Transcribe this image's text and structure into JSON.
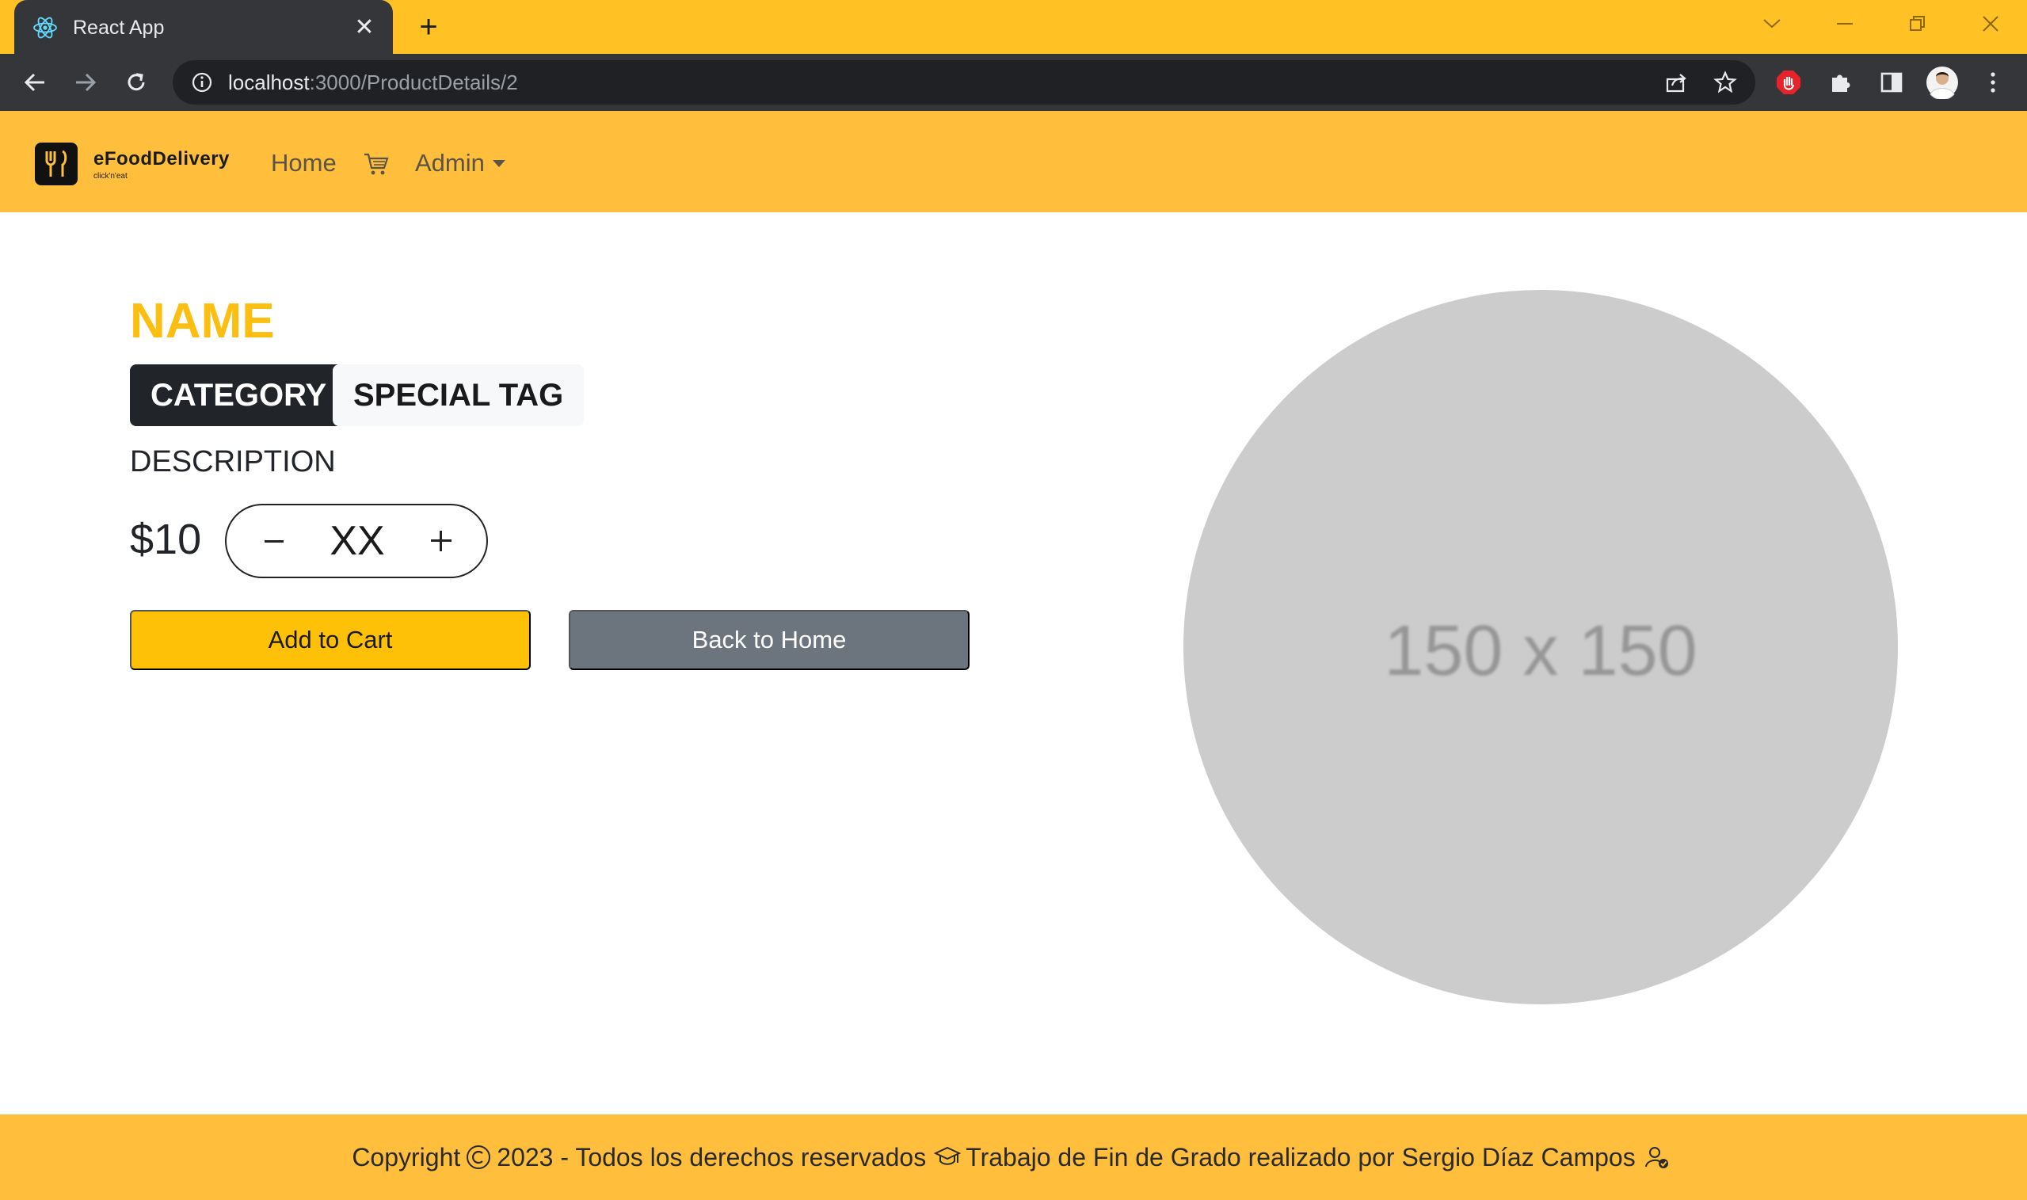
{
  "browser": {
    "tab_title": "React App",
    "url_host": "localhost",
    "url_rest": ":3000/ProductDetails/2"
  },
  "navbar": {
    "brand_name": "eFoodDelivery",
    "brand_tagline": "click'n'eat",
    "home_label": "Home",
    "admin_label": "Admin"
  },
  "product": {
    "name": "NAME",
    "category": "CATEGORY",
    "special_tag": "SPECIAL TAG",
    "description": "DESCRIPTION",
    "price": "$10",
    "quantity": "XX",
    "add_to_cart_label": "Add to Cart",
    "back_home_label": "Back to Home",
    "image_placeholder": "150 x 150"
  },
  "footer": {
    "copyright": "Copyright",
    "year_text": "2023 - Todos los derechos reservados",
    "credit_text": "Trabajo de Fin de Grado realizado por Sergio Díaz Campos"
  },
  "colors": {
    "accent": "#ffbe3b",
    "title": "#fcbe11",
    "add_button": "#ffc107",
    "back_button": "#6c757d"
  }
}
